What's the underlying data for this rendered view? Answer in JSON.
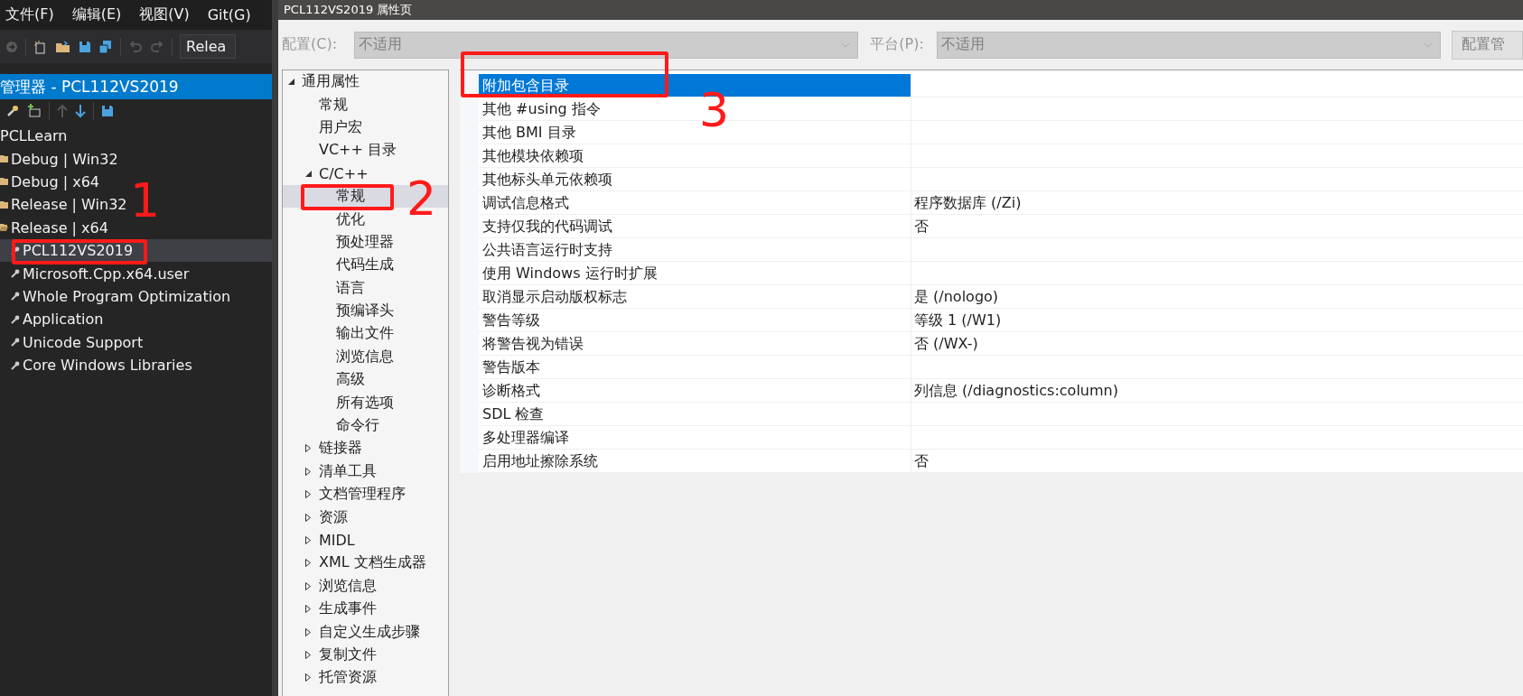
{
  "menu": [
    "文件(F)",
    "编辑(E)",
    "视图(V)",
    "Git(G)"
  ],
  "toolbar": {
    "config_dropdown": "Relea"
  },
  "property_manager": {
    "title": "管理器 - PCL112VS2019",
    "tree": [
      {
        "label": "PCLLearn",
        "selected": false,
        "children": [
          {
            "label": "Debug | Win32",
            "kind": "config",
            "expanded": false,
            "selected": false
          },
          {
            "label": "Debug | x64",
            "kind": "config",
            "expanded": false,
            "selected": false
          },
          {
            "label": "Release | Win32",
            "kind": "config",
            "expanded": false,
            "selected": false
          },
          {
            "label": "Release | x64",
            "kind": "config",
            "expanded": true,
            "selected": false,
            "children": [
              {
                "label": "PCL112VS2019",
                "kind": "sheet",
                "selected": true
              },
              {
                "label": "Microsoft.Cpp.x64.user",
                "kind": "sheet",
                "selected": false
              },
              {
                "label": "Whole Program Optimization",
                "kind": "sheet",
                "selected": false
              },
              {
                "label": "Application",
                "kind": "sheet",
                "selected": false
              },
              {
                "label": "Unicode Support",
                "kind": "sheet",
                "selected": false
              },
              {
                "label": "Core Windows Libraries",
                "kind": "sheet",
                "selected": false
              }
            ]
          }
        ]
      }
    ]
  },
  "dialog": {
    "title": "PCL112VS2019 属性页",
    "config_label": "配置(C):",
    "config_value": "不适用",
    "platform_label": "平台(P):",
    "platform_value": "不适用",
    "config_manager_button": "配置管",
    "property_tree": [
      {
        "label": "通用属性",
        "expanded": true,
        "selected": false,
        "children": [
          {
            "label": "常规",
            "selected": false
          },
          {
            "label": "用户宏",
            "selected": false
          },
          {
            "label": "VC++ 目录",
            "selected": false
          },
          {
            "label": "C/C++",
            "expanded": true,
            "selected": false,
            "children": [
              {
                "label": "常规",
                "selected": true
              },
              {
                "label": "优化",
                "selected": false
              },
              {
                "label": "预处理器",
                "selected": false
              },
              {
                "label": "代码生成",
                "selected": false
              },
              {
                "label": "语言",
                "selected": false
              },
              {
                "label": "预编译头",
                "selected": false
              },
              {
                "label": "输出文件",
                "selected": false
              },
              {
                "label": "浏览信息",
                "selected": false
              },
              {
                "label": "高级",
                "selected": false
              },
              {
                "label": "所有选项",
                "selected": false
              },
              {
                "label": "命令行",
                "selected": false
              }
            ]
          },
          {
            "label": "链接器",
            "expanded": false,
            "selected": false
          },
          {
            "label": "清单工具",
            "expanded": false,
            "selected": false
          },
          {
            "label": "文档管理程序",
            "expanded": false,
            "selected": false
          },
          {
            "label": "资源",
            "expanded": false,
            "selected": false
          },
          {
            "label": "MIDL",
            "expanded": false,
            "selected": false
          },
          {
            "label": "XML 文档生成器",
            "expanded": false,
            "selected": false
          },
          {
            "label": "浏览信息",
            "expanded": false,
            "selected": false
          },
          {
            "label": "生成事件",
            "expanded": false,
            "selected": false
          },
          {
            "label": "自定义生成步骤",
            "expanded": false,
            "selected": false
          },
          {
            "label": "复制文件",
            "expanded": false,
            "selected": false
          },
          {
            "label": "托管资源",
            "expanded": false,
            "selected": false
          }
        ]
      }
    ],
    "properties": [
      {
        "name": "附加包含目录",
        "selected": true
      },
      {
        "name": "其他 #using 指令",
        "selected": false
      },
      {
        "name": "其他 BMI 目录",
        "selected": false
      },
      {
        "name": "其他模块依赖项",
        "selected": false
      },
      {
        "name": "其他标头单元依赖项",
        "selected": false
      },
      {
        "name": "调试信息格式",
        "value": "程序数据库 (/Zi)",
        "selected": false
      },
      {
        "name": "支持仅我的代码调试",
        "value": "否",
        "selected": false
      },
      {
        "name": "公共语言运行时支持",
        "selected": false
      },
      {
        "name": "使用 Windows 运行时扩展",
        "selected": false
      },
      {
        "name": "取消显示启动版权标志",
        "value": "是 (/nologo)",
        "selected": false
      },
      {
        "name": "警告等级",
        "value": "等级 1 (/W1)",
        "selected": false
      },
      {
        "name": "将警告视为错误",
        "value": "否 (/WX-)",
        "selected": false
      },
      {
        "name": "警告版本",
        "selected": false
      },
      {
        "name": "诊断格式",
        "value": "列信息 (/diagnostics:column)",
        "selected": false
      },
      {
        "name": "SDL 检查",
        "selected": false
      },
      {
        "name": "多处理器编译",
        "selected": false
      },
      {
        "name": "启用地址擦除系统",
        "value": "否",
        "selected": false
      }
    ]
  },
  "annotations": [
    {
      "label": "1"
    },
    {
      "label": "2"
    },
    {
      "label": "3"
    }
  ]
}
